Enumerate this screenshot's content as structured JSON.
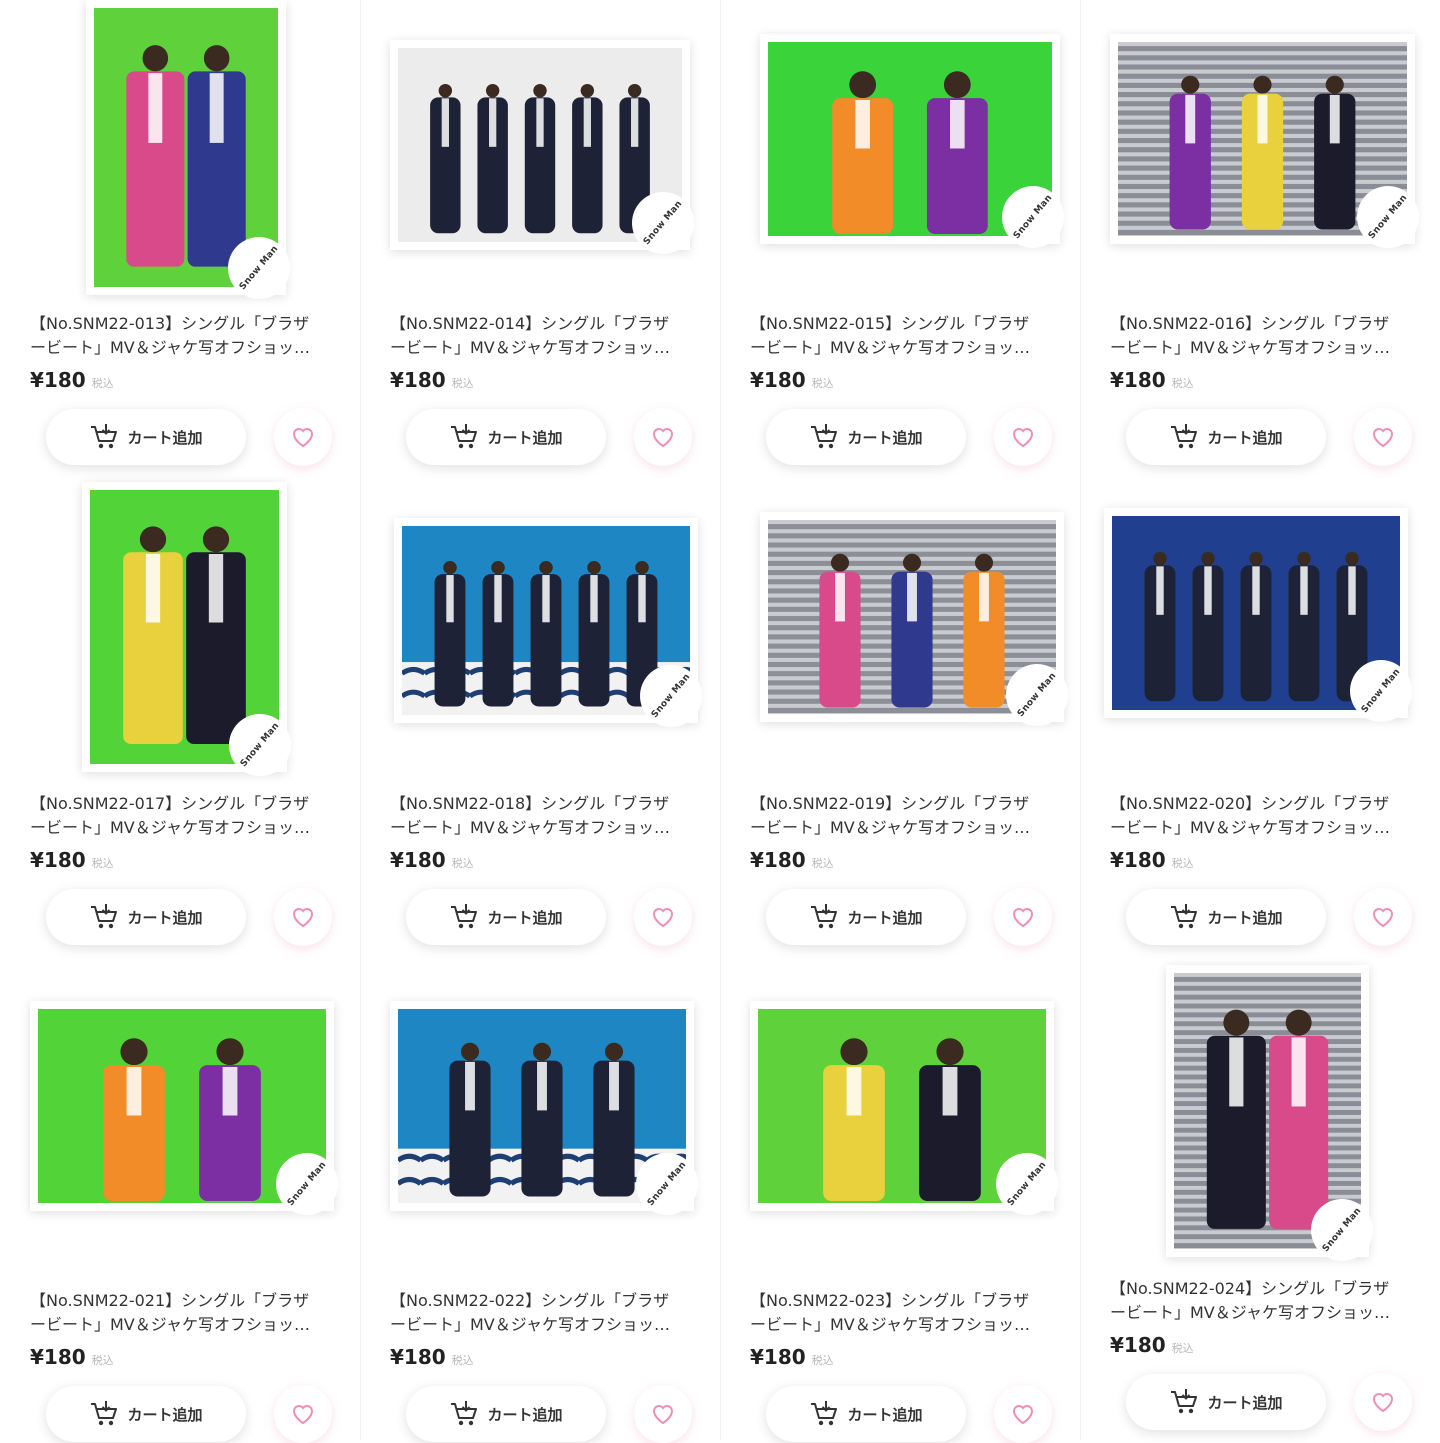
{
  "products": [
    {
      "title_line1": "【No.SNM22-013】シングル「ブラザ",
      "title_line2": "ービート」MV＆ジャケ写オフショッ…",
      "price": "¥180",
      "tax": "税込",
      "cart_label": "カート追加",
      "logo": "Snow Man",
      "bg": "#5fd13a"
    },
    {
      "title_line1": "【No.SNM22-014】シングル「ブラザ",
      "title_line2": "ービート」MV＆ジャケ写オフショッ…",
      "price": "¥180",
      "tax": "税込",
      "cart_label": "カート追加",
      "logo": "Snow Man",
      "bg": "#ececec"
    },
    {
      "title_line1": "【No.SNM22-015】シングル「ブラザ",
      "title_line2": "ービート」MV＆ジャケ写オフショッ…",
      "price": "¥180",
      "tax": "税込",
      "cart_label": "カート追加",
      "logo": "Snow Man",
      "bg": "#3bd33a"
    },
    {
      "title_line1": "【No.SNM22-016】シングル「ブラザ",
      "title_line2": "ービート」MV＆ジャケ写オフショッ…",
      "price": "¥180",
      "tax": "税込",
      "cart_label": "カート追加",
      "logo": "Snow Man",
      "bg": "#8a8d95"
    },
    {
      "title_line1": "【No.SNM22-017】シングル「ブラザ",
      "title_line2": "ービート」MV＆ジャケ写オフショッ…",
      "price": "¥180",
      "tax": "税込",
      "cart_label": "カート追加",
      "logo": "Snow Man",
      "bg": "#52d338"
    },
    {
      "title_line1": "【No.SNM22-018】シングル「ブラザ",
      "title_line2": "ービート」MV＆ジャケ写オフショッ…",
      "price": "¥180",
      "tax": "税込",
      "cart_label": "カート追加",
      "logo": "Snow Man",
      "bg": "#1f86c4"
    },
    {
      "title_line1": "【No.SNM22-019】シングル「ブラザ",
      "title_line2": "ービート」MV＆ジャケ写オフショッ…",
      "price": "¥180",
      "tax": "税込",
      "cart_label": "カート追加",
      "logo": "Snow Man",
      "bg": "#8c8f96"
    },
    {
      "title_line1": "【No.SNM22-020】シングル「ブラザ",
      "title_line2": "ービート」MV＆ジャケ写オフショッ…",
      "price": "¥180",
      "tax": "税込",
      "cart_label": "カート追加",
      "logo": "Snow Man",
      "bg": "#203f8f"
    },
    {
      "title_line1": "【No.SNM22-021】シングル「ブラザ",
      "title_line2": "ービート」MV＆ジャケ写オフショッ…",
      "price": "¥180",
      "tax": "税込",
      "cart_label": "カート追加",
      "logo": "Snow Man",
      "bg": "#52d338"
    },
    {
      "title_line1": "【No.SNM22-022】シングル「ブラザ",
      "title_line2": "ービート」MV＆ジャケ写オフショッ…",
      "price": "¥180",
      "tax": "税込",
      "cart_label": "カート追加",
      "logo": "Snow Man",
      "bg": "#1f86c4"
    },
    {
      "title_line1": "【No.SNM22-023】シングル「ブラザ",
      "title_line2": "ービート」MV＆ジャケ写オフショッ…",
      "price": "¥180",
      "tax": "税込",
      "cart_label": "カート追加",
      "logo": "Snow Man",
      "bg": "#5fd13a"
    },
    {
      "title_line1": "【No.SNM22-024】シングル「ブラザ",
      "title_line2": "ービート」MV＆ジャケ写オフショッ…",
      "price": "¥180",
      "tax": "税込",
      "cart_label": "カート追加",
      "logo": "Snow Man",
      "bg": "#8a8d95"
    }
  ],
  "colors": {
    "heart": "#ee8fb4",
    "text": "#333333",
    "tax": "#b8b8b8"
  },
  "icons": {
    "cart": "cart-icon",
    "heart": "heart-icon"
  }
}
